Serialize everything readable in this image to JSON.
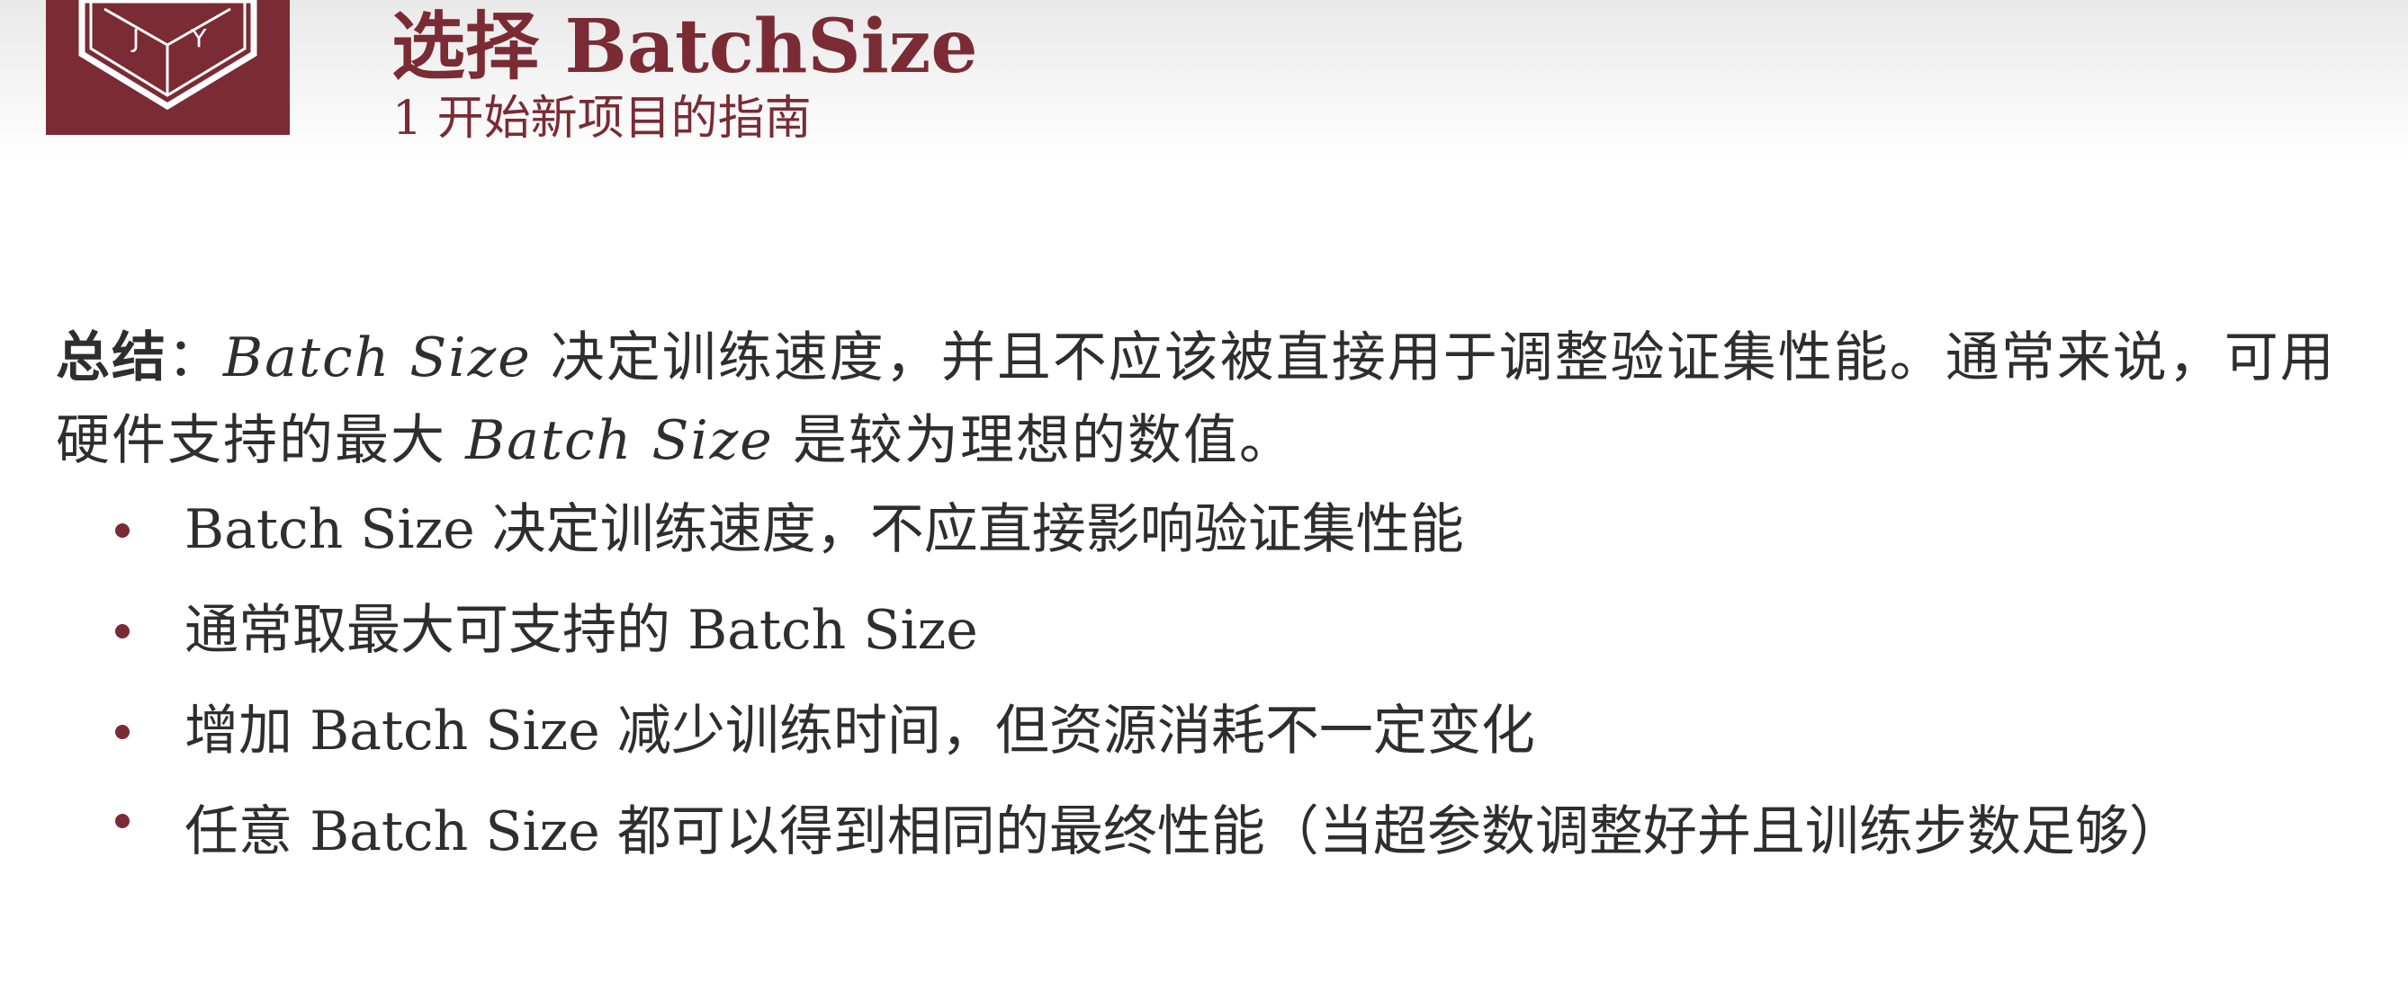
{
  "logo": {
    "letters": [
      "J",
      "Y"
    ],
    "icon": "cube-logo-icon"
  },
  "header": {
    "title": "选择 BatchSize",
    "subtitle": "1  开始新项目的指南"
  },
  "summary": {
    "label": "总结",
    "colon": "：",
    "part1": "Batch Size",
    "part2": " 决定训练速度，并且不应该被直接用于调整验证集性能。通常来说，可用硬件支持的最大 ",
    "part3": "Batch Size",
    "part4": " 是较为理想的数值。"
  },
  "bullets": [
    "Batch Size 决定训练速度，不应直接影响验证集性能",
    "通常取最大可支持的 Batch Size",
    "增加 Batch Size 减少训练时间，但资源消耗不一定变化",
    "任意 Batch Size 都可以得到相同的最终性能（当超参数调整好并且训练步数足够）"
  ],
  "colors": {
    "accent": "#7a2b33",
    "text": "#2e2e2e"
  }
}
